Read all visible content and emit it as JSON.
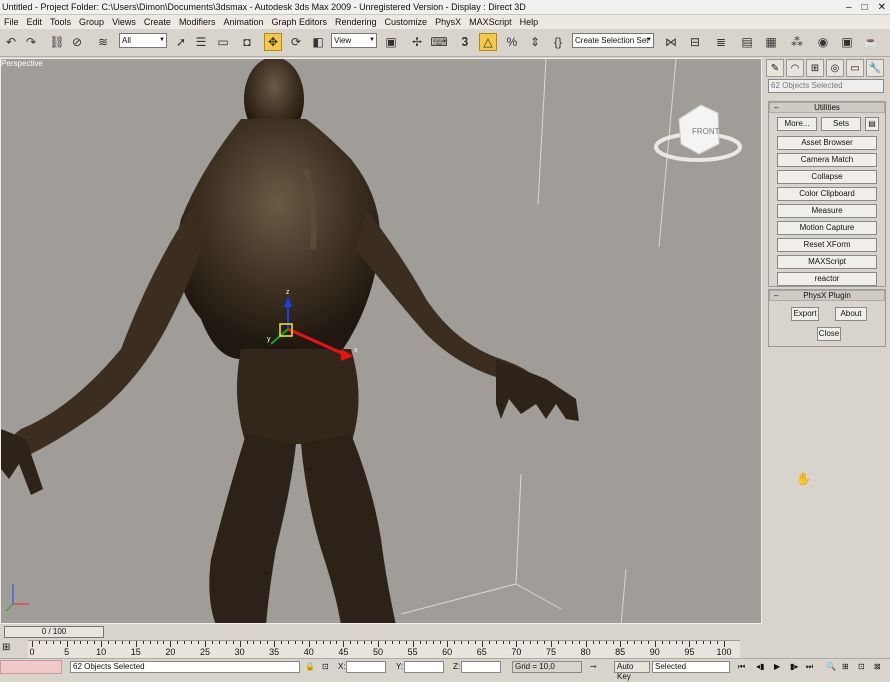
{
  "window": {
    "title": "Untitled    - Project Folder: C:\\Users\\Dimon\\Documents\\3dsmax    - Autodesk 3ds Max  2009    - Unregistered Version    - Display : Direct 3D"
  },
  "menu": [
    "File",
    "Edit",
    "Tools",
    "Group",
    "Views",
    "Create",
    "Modifiers",
    "Animation",
    "Graph Editors",
    "Rendering",
    "Customize",
    "PhysX",
    "MAXScript",
    "Help"
  ],
  "toolbar": {
    "selection_filter": "All",
    "reference_coord": "View",
    "named_selection": "Create Selection Set"
  },
  "viewport": {
    "label": "Perspective",
    "viewcube_label": "FRONT",
    "gizmo_axes": [
      "z",
      "x",
      "y"
    ]
  },
  "command_panel": {
    "selection_field": "62 Objects Selected",
    "utilities": {
      "title": "Utilities",
      "more_label": "More...",
      "sets_label": "Sets",
      "buttons": [
        "Asset Browser",
        "Camera Match",
        "Collapse",
        "Color Clipboard",
        "Measure",
        "Motion Capture",
        "Reset XForm",
        "MAXScript",
        "reactor"
      ]
    },
    "physx": {
      "title": "PhysX Plugin",
      "export_label": "Export",
      "about_label": "About",
      "close_label": "Close"
    }
  },
  "timeline": {
    "slider_text": "0 / 100",
    "tick_labels": [
      "0",
      "5",
      "10",
      "15",
      "20",
      "25",
      "30",
      "35",
      "40",
      "45",
      "50",
      "55",
      "60",
      "65",
      "70",
      "75",
      "80",
      "85",
      "90",
      "95",
      "100"
    ]
  },
  "status": {
    "selected_text": "62 Objects Selected",
    "x_label": "X:",
    "y_label": "Y:",
    "z_label": "Z:",
    "grid_text": "Grid = 10,0",
    "autokey_label": "Auto Key",
    "key_filter": "Selected"
  },
  "colors": {
    "viewport_bg": "#a09c98",
    "ui_bg": "#d8d4cc",
    "active_tool": "#f5c84a"
  }
}
